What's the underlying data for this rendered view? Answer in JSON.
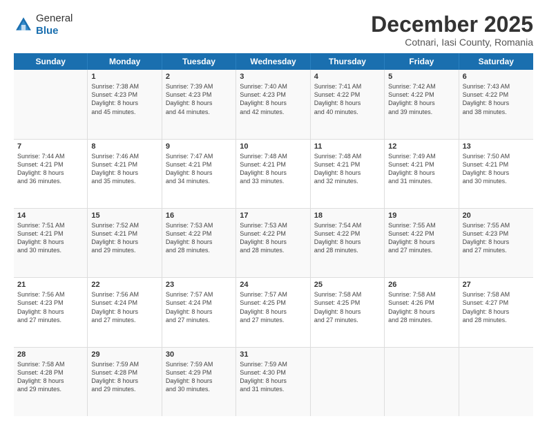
{
  "header": {
    "logo_general": "General",
    "logo_blue": "Blue",
    "main_title": "December 2025",
    "subtitle": "Cotnari, Iasi County, Romania"
  },
  "days_of_week": [
    "Sunday",
    "Monday",
    "Tuesday",
    "Wednesday",
    "Thursday",
    "Friday",
    "Saturday"
  ],
  "weeks": [
    [
      {
        "day": "",
        "info": ""
      },
      {
        "day": "1",
        "info": "Sunrise: 7:38 AM\nSunset: 4:23 PM\nDaylight: 8 hours\nand 45 minutes."
      },
      {
        "day": "2",
        "info": "Sunrise: 7:39 AM\nSunset: 4:23 PM\nDaylight: 8 hours\nand 44 minutes."
      },
      {
        "day": "3",
        "info": "Sunrise: 7:40 AM\nSunset: 4:23 PM\nDaylight: 8 hours\nand 42 minutes."
      },
      {
        "day": "4",
        "info": "Sunrise: 7:41 AM\nSunset: 4:22 PM\nDaylight: 8 hours\nand 40 minutes."
      },
      {
        "day": "5",
        "info": "Sunrise: 7:42 AM\nSunset: 4:22 PM\nDaylight: 8 hours\nand 39 minutes."
      },
      {
        "day": "6",
        "info": "Sunrise: 7:43 AM\nSunset: 4:22 PM\nDaylight: 8 hours\nand 38 minutes."
      }
    ],
    [
      {
        "day": "7",
        "info": "Sunrise: 7:44 AM\nSunset: 4:21 PM\nDaylight: 8 hours\nand 36 minutes."
      },
      {
        "day": "8",
        "info": "Sunrise: 7:46 AM\nSunset: 4:21 PM\nDaylight: 8 hours\nand 35 minutes."
      },
      {
        "day": "9",
        "info": "Sunrise: 7:47 AM\nSunset: 4:21 PM\nDaylight: 8 hours\nand 34 minutes."
      },
      {
        "day": "10",
        "info": "Sunrise: 7:48 AM\nSunset: 4:21 PM\nDaylight: 8 hours\nand 33 minutes."
      },
      {
        "day": "11",
        "info": "Sunrise: 7:48 AM\nSunset: 4:21 PM\nDaylight: 8 hours\nand 32 minutes."
      },
      {
        "day": "12",
        "info": "Sunrise: 7:49 AM\nSunset: 4:21 PM\nDaylight: 8 hours\nand 31 minutes."
      },
      {
        "day": "13",
        "info": "Sunrise: 7:50 AM\nSunset: 4:21 PM\nDaylight: 8 hours\nand 30 minutes."
      }
    ],
    [
      {
        "day": "14",
        "info": "Sunrise: 7:51 AM\nSunset: 4:21 PM\nDaylight: 8 hours\nand 30 minutes."
      },
      {
        "day": "15",
        "info": "Sunrise: 7:52 AM\nSunset: 4:21 PM\nDaylight: 8 hours\nand 29 minutes."
      },
      {
        "day": "16",
        "info": "Sunrise: 7:53 AM\nSunset: 4:22 PM\nDaylight: 8 hours\nand 28 minutes."
      },
      {
        "day": "17",
        "info": "Sunrise: 7:53 AM\nSunset: 4:22 PM\nDaylight: 8 hours\nand 28 minutes."
      },
      {
        "day": "18",
        "info": "Sunrise: 7:54 AM\nSunset: 4:22 PM\nDaylight: 8 hours\nand 28 minutes."
      },
      {
        "day": "19",
        "info": "Sunrise: 7:55 AM\nSunset: 4:22 PM\nDaylight: 8 hours\nand 27 minutes."
      },
      {
        "day": "20",
        "info": "Sunrise: 7:55 AM\nSunset: 4:23 PM\nDaylight: 8 hours\nand 27 minutes."
      }
    ],
    [
      {
        "day": "21",
        "info": "Sunrise: 7:56 AM\nSunset: 4:23 PM\nDaylight: 8 hours\nand 27 minutes."
      },
      {
        "day": "22",
        "info": "Sunrise: 7:56 AM\nSunset: 4:24 PM\nDaylight: 8 hours\nand 27 minutes."
      },
      {
        "day": "23",
        "info": "Sunrise: 7:57 AM\nSunset: 4:24 PM\nDaylight: 8 hours\nand 27 minutes."
      },
      {
        "day": "24",
        "info": "Sunrise: 7:57 AM\nSunset: 4:25 PM\nDaylight: 8 hours\nand 27 minutes."
      },
      {
        "day": "25",
        "info": "Sunrise: 7:58 AM\nSunset: 4:25 PM\nDaylight: 8 hours\nand 27 minutes."
      },
      {
        "day": "26",
        "info": "Sunrise: 7:58 AM\nSunset: 4:26 PM\nDaylight: 8 hours\nand 28 minutes."
      },
      {
        "day": "27",
        "info": "Sunrise: 7:58 AM\nSunset: 4:27 PM\nDaylight: 8 hours\nand 28 minutes."
      }
    ],
    [
      {
        "day": "28",
        "info": "Sunrise: 7:58 AM\nSunset: 4:28 PM\nDaylight: 8 hours\nand 29 minutes."
      },
      {
        "day": "29",
        "info": "Sunrise: 7:59 AM\nSunset: 4:28 PM\nDaylight: 8 hours\nand 29 minutes."
      },
      {
        "day": "30",
        "info": "Sunrise: 7:59 AM\nSunset: 4:29 PM\nDaylight: 8 hours\nand 30 minutes."
      },
      {
        "day": "31",
        "info": "Sunrise: 7:59 AM\nSunset: 4:30 PM\nDaylight: 8 hours\nand 31 minutes."
      },
      {
        "day": "",
        "info": ""
      },
      {
        "day": "",
        "info": ""
      },
      {
        "day": "",
        "info": ""
      }
    ]
  ]
}
